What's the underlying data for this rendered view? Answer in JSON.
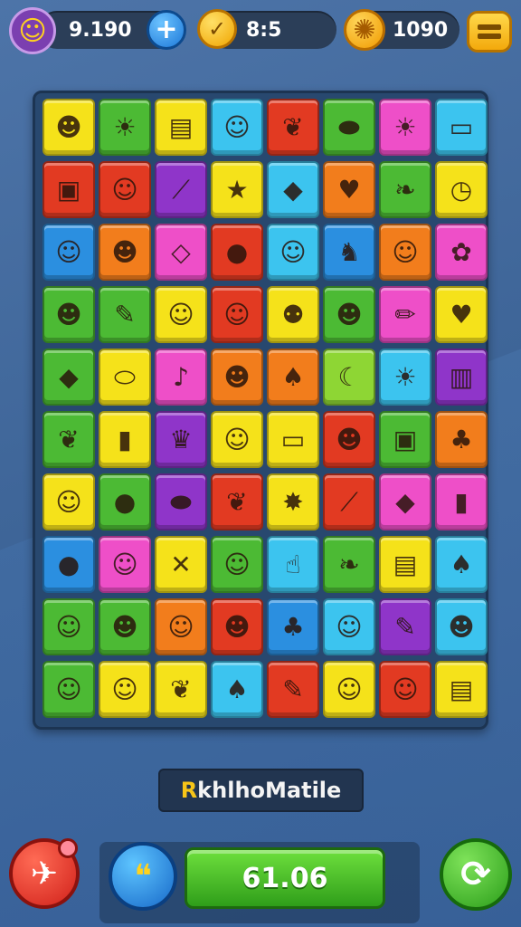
{
  "top_bar": {
    "player_score": "9.190",
    "add_label": "+",
    "coin_count": "8:5",
    "coin_symbol": "✓",
    "gear_count": "1090",
    "gear_symbol": "✺",
    "avatar_symbol": "☺"
  },
  "board": {
    "rows": [
      [
        {
          "color": "yellow",
          "icon": "face-icon",
          "glyph": "☻"
        },
        {
          "color": "green",
          "icon": "sun-face-icon",
          "glyph": "☀"
        },
        {
          "color": "yellow",
          "icon": "trash-can-icon",
          "glyph": "▤"
        },
        {
          "color": "cyan",
          "icon": "cat-face-icon",
          "glyph": "☺"
        },
        {
          "color": "red",
          "icon": "leaf-icon",
          "glyph": "❦"
        },
        {
          "color": "green",
          "icon": "cucumber-icon",
          "glyph": "⬬"
        },
        {
          "color": "pink",
          "icon": "sun-icon",
          "glyph": "☀"
        },
        {
          "color": "cyan",
          "icon": "id-card-icon",
          "glyph": "▭"
        }
      ],
      [
        {
          "color": "red",
          "icon": "box-icon",
          "glyph": "▣"
        },
        {
          "color": "red",
          "icon": "clown-face-icon",
          "glyph": "☺"
        },
        {
          "color": "purple",
          "icon": "bone-icon",
          "glyph": "⟋"
        },
        {
          "color": "yellow",
          "icon": "star-icon",
          "glyph": "★"
        },
        {
          "color": "cyan",
          "icon": "fish-icon",
          "glyph": "◆"
        },
        {
          "color": "orange",
          "icon": "heart-icon",
          "glyph": "♥"
        },
        {
          "color": "green",
          "icon": "bread-icon",
          "glyph": "❧"
        },
        {
          "color": "yellow",
          "icon": "clock-icon",
          "glyph": "◷"
        }
      ],
      [
        {
          "color": "blue",
          "icon": "smiley-icon",
          "glyph": "☺"
        },
        {
          "color": "orange",
          "icon": "smiley-icon",
          "glyph": "☻"
        },
        {
          "color": "pink",
          "icon": "kite-icon",
          "glyph": "◇"
        },
        {
          "color": "red",
          "icon": "bun-icon",
          "glyph": "●"
        },
        {
          "color": "cyan",
          "icon": "blob-face-icon",
          "glyph": "☺"
        },
        {
          "color": "blue",
          "icon": "fox-icon",
          "glyph": "♞"
        },
        {
          "color": "orange",
          "icon": "baby-face-icon",
          "glyph": "☺"
        },
        {
          "color": "pink",
          "icon": "flower-icon",
          "glyph": "✿"
        }
      ],
      [
        {
          "color": "green",
          "icon": "cool-cat-icon",
          "glyph": "☻"
        },
        {
          "color": "green",
          "icon": "pencil-icon",
          "glyph": "✎"
        },
        {
          "color": "yellow",
          "icon": "onion-face-icon",
          "glyph": "☺"
        },
        {
          "color": "red",
          "icon": "baby-face-icon",
          "glyph": "☺"
        },
        {
          "color": "yellow",
          "icon": "bubbles-icon",
          "glyph": "⚉"
        },
        {
          "color": "green",
          "icon": "alien-face-icon",
          "glyph": "☻"
        },
        {
          "color": "pink",
          "icon": "pencil-icon",
          "glyph": "✏"
        },
        {
          "color": "yellow",
          "icon": "heart-icon",
          "glyph": "♥"
        }
      ],
      [
        {
          "color": "green",
          "icon": "fish-icon",
          "glyph": "◆"
        },
        {
          "color": "yellow",
          "icon": "bandage-icon",
          "glyph": "⬭"
        },
        {
          "color": "pink",
          "icon": "ribbon-icon",
          "glyph": "♪"
        },
        {
          "color": "orange",
          "icon": "sunglasses-face-icon",
          "glyph": "☻"
        },
        {
          "color": "orange",
          "icon": "bell-pepper-icon",
          "glyph": "♠"
        },
        {
          "color": "lime",
          "icon": "bananas-icon",
          "glyph": "☾"
        },
        {
          "color": "cyan",
          "icon": "sun-face-icon",
          "glyph": "☀"
        },
        {
          "color": "purple",
          "icon": "cup-icon",
          "glyph": "▥"
        }
      ],
      [
        {
          "color": "green",
          "icon": "leaf-icon",
          "glyph": "❦"
        },
        {
          "color": "yellow",
          "icon": "bottle-icon",
          "glyph": "▮"
        },
        {
          "color": "purple",
          "icon": "crown-icon",
          "glyph": "♛"
        },
        {
          "color": "yellow",
          "icon": "blob-face-icon",
          "glyph": "☺"
        },
        {
          "color": "yellow",
          "icon": "chat-icon",
          "glyph": "▭"
        },
        {
          "color": "red",
          "icon": "sunglasses-face-icon",
          "glyph": "☻"
        },
        {
          "color": "green",
          "icon": "gift-box-icon",
          "glyph": "▣"
        },
        {
          "color": "orange",
          "icon": "palm-tree-icon",
          "glyph": "♣"
        }
      ],
      [
        {
          "color": "yellow",
          "icon": "onion-face-icon",
          "glyph": "☺"
        },
        {
          "color": "green",
          "icon": "cookie-icon",
          "glyph": "●"
        },
        {
          "color": "purple",
          "icon": "capsule-icon",
          "glyph": "⬬"
        },
        {
          "color": "red",
          "icon": "leaf-icon",
          "glyph": "❦"
        },
        {
          "color": "yellow",
          "icon": "splash-icon",
          "glyph": "✸"
        },
        {
          "color": "red",
          "icon": "safety-pin-icon",
          "glyph": "⟋"
        },
        {
          "color": "pink",
          "icon": "fish-icon",
          "glyph": "◆"
        },
        {
          "color": "pink",
          "icon": "bottle-icon",
          "glyph": "▮"
        }
      ],
      [
        {
          "color": "blue",
          "icon": "ball-icon",
          "glyph": "●"
        },
        {
          "color": "pink",
          "icon": "baby-face-icon",
          "glyph": "☺"
        },
        {
          "color": "yellow",
          "icon": "crossed-tools-icon",
          "glyph": "✕"
        },
        {
          "color": "green",
          "icon": "cat-face-icon",
          "glyph": "☺"
        },
        {
          "color": "cyan",
          "icon": "thumbs-up-icon",
          "glyph": "☝"
        },
        {
          "color": "green",
          "icon": "bread-icon",
          "glyph": "❧"
        },
        {
          "color": "yellow",
          "icon": "juice-box-icon",
          "glyph": "▤"
        },
        {
          "color": "cyan",
          "icon": "acorn-icon",
          "glyph": "♠"
        }
      ],
      [
        {
          "color": "green",
          "icon": "pea-face-icon",
          "glyph": "☺"
        },
        {
          "color": "green",
          "icon": "alien-face-icon",
          "glyph": "☻"
        },
        {
          "color": "orange",
          "icon": "onion-face-icon",
          "glyph": "☺"
        },
        {
          "color": "red",
          "icon": "zombie-face-icon",
          "glyph": "☻"
        },
        {
          "color": "blue",
          "icon": "palm-tree-icon",
          "glyph": "♣"
        },
        {
          "color": "cyan",
          "icon": "onion-face-icon",
          "glyph": "☺"
        },
        {
          "color": "purple",
          "icon": "carrot-icon",
          "glyph": "✎"
        },
        {
          "color": "cyan",
          "icon": "coconut-face-icon",
          "glyph": "☻"
        }
      ],
      [
        {
          "color": "green",
          "icon": "pig-face-icon",
          "glyph": "☺"
        },
        {
          "color": "yellow",
          "icon": "lemon-face-icon",
          "glyph": "☺"
        },
        {
          "color": "yellow",
          "icon": "leaf-icon",
          "glyph": "❦"
        },
        {
          "color": "cyan",
          "icon": "bell-pepper-icon",
          "glyph": "♠"
        },
        {
          "color": "red",
          "icon": "carrot-icon",
          "glyph": "✎"
        },
        {
          "color": "yellow",
          "icon": "blob-face-icon",
          "glyph": "☺"
        },
        {
          "color": "red",
          "icon": "baby-face-icon",
          "glyph": "☺"
        },
        {
          "color": "yellow",
          "icon": "notepad-icon",
          "glyph": "▤"
        }
      ]
    ]
  },
  "title": {
    "first": "R",
    "rest": "khlhoMatile"
  },
  "bottom": {
    "left_button_symbol": "✈",
    "hint_symbol": "❝",
    "score_value": "61.06",
    "refresh_symbol": "⟳"
  }
}
